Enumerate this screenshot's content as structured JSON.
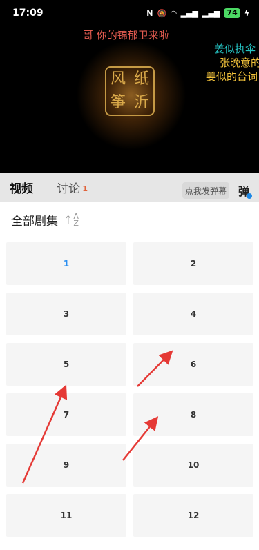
{
  "status_bar": {
    "time": "17:09",
    "battery": "74"
  },
  "video": {
    "logo_chars": [
      "风",
      "纸",
      "筝",
      "沂"
    ],
    "danmaku": [
      "哥 你的锦郁卫来啦",
      "姜似执伞",
      "张晚意的",
      "姜似的台词"
    ]
  },
  "tabs": [
    {
      "label": "视频"
    },
    {
      "label": "讨论",
      "count": "1"
    }
  ],
  "danmu": {
    "send_label": "点我发弹幕",
    "toggle_label": "弹"
  },
  "panel": {
    "title": "全部剧集",
    "sort_a": "A",
    "sort_z": "Z"
  },
  "episodes": [
    "1",
    "2",
    "3",
    "4",
    "5",
    "6",
    "7",
    "8",
    "9",
    "10",
    "11",
    "12"
  ],
  "colors": {
    "accent": "#2b8ff0",
    "arrow": "#e53935"
  }
}
